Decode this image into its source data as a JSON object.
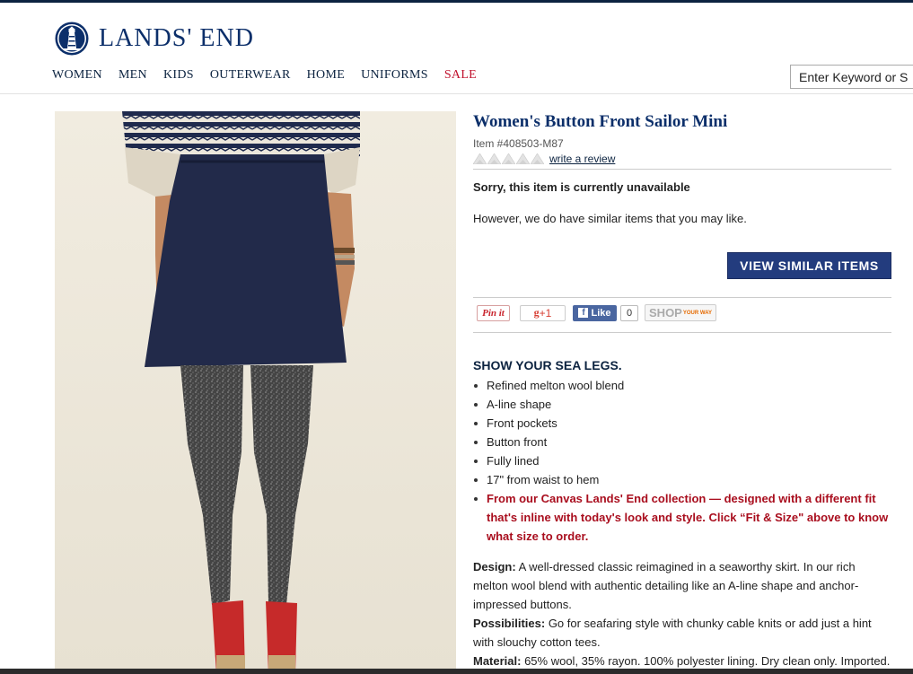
{
  "brand": {
    "name": "LANDS' END",
    "logo_icon": "lighthouse-icon",
    "color": "#0c2f6a"
  },
  "nav": {
    "items": [
      "WOMEN",
      "MEN",
      "KIDS",
      "OUTERWEAR",
      "HOME",
      "UNIFORMS"
    ],
    "sale": "SALE",
    "sale_color": "#c0112d"
  },
  "search": {
    "placeholder": "Enter Keyword or S"
  },
  "product": {
    "title": "Women's Button Front Sailor Mini",
    "item_number": "Item #408503-M87",
    "rating_stars": 0,
    "write_review": "write a review",
    "unavailable": "Sorry, this item is currently unavailable",
    "similar_text": "However, we do have similar items that you may like.",
    "view_similar": "VIEW SIMILAR ITEMS",
    "view_similar_color": "#233c7e"
  },
  "social": {
    "pinterest": "Pin it",
    "gplus": "+1",
    "facebook": "Like",
    "facebook_count": "0",
    "shopyourway": "SHOP",
    "shopyourway_sup": "YOUR WAY"
  },
  "details": {
    "headline": "SHOW YOUR SEA LEGS.",
    "features": [
      "Refined melton wool blend",
      "A-line shape",
      "Front pockets",
      "Button front",
      "Fully lined",
      "17\" from waist to hem"
    ],
    "canvas_note": "From our Canvas Lands' End collection — designed with a different fit that's inline with today's look and style. Click “Fit & Size\" above to know what size to order.",
    "design_label": "Design:",
    "design_text": " A well-dressed classic reimagined in a seaworthy skirt. In our rich melton wool blend with authentic detailing like an A-line shape and anchor-impressed buttons.",
    "possibilities_label": "Possibilities:",
    "possibilities_text": " Go for seafaring style with chunky cable knits or add just a hint with slouchy cotton tees.",
    "material_label": "Material:",
    "material_text": " 65% wool, 35% rayon. 100% polyester lining. Dry clean only. Imported."
  }
}
